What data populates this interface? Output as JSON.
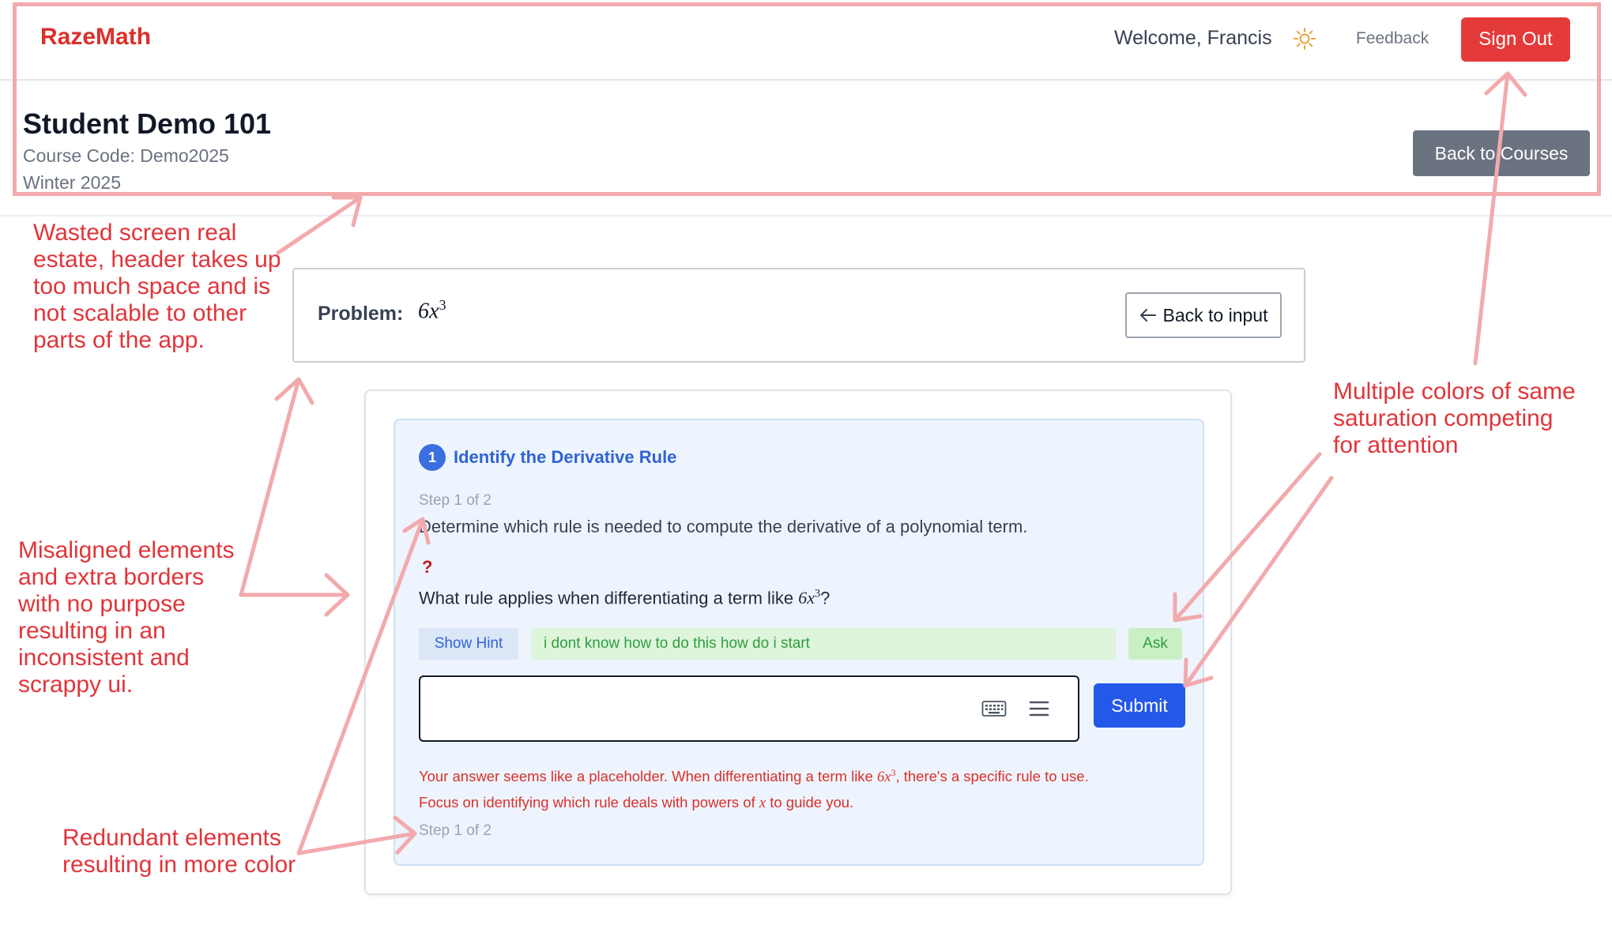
{
  "nav": {
    "brand": "RazeMath",
    "welcome": "Welcome, Francis",
    "theme_icon": "sun-icon",
    "feedback": "Feedback",
    "sign_out": "Sign Out"
  },
  "course": {
    "title": "Student Demo 101",
    "code": "Course Code: Demo2025",
    "term": "Winter 2025",
    "back_button": "Back to Courses"
  },
  "problem": {
    "label": "Problem:",
    "expression_base": "6x",
    "expression_exp": "3",
    "back_button": "Back to input",
    "back_icon": "arrow-left-icon"
  },
  "step": {
    "number": "1",
    "title": "Identify the Derivative Rule",
    "count": "Step 1 of 2",
    "description": "Determine which rule is needed to compute the derivative of a polynomial term.",
    "question_mark": "?",
    "question_prefix": "What rule applies when differentiating a term like ",
    "question_term": "6x",
    "question_exp": "3",
    "question_suffix": "?",
    "show_hint": "Show Hint",
    "hint_question": "i dont know how to do this how do i start",
    "ask": "Ask",
    "answer_value": "",
    "keyboard_icon": "keyboard-icon",
    "menu_icon": "menu-icon",
    "submit": "Submit",
    "feedback_line1_a": "Your answer seems like a placeholder. When differentiating a term like ",
    "feedback_term": "6x",
    "feedback_exp": "3",
    "feedback_line1_b": ", there's a specific rule to use.",
    "feedback_line2_a": "Focus on identifying which rule deals with powers of ",
    "feedback_var": "x",
    "feedback_line2_b": " to guide you.",
    "count_bottom": "Step 1 of 2"
  },
  "annotations": {
    "color": "#e0353a",
    "header": [
      "Wasted screen real",
      "estate, header takes up",
      "too much space and is",
      "not scalable to other",
      "parts of the app."
    ],
    "misaligned": [
      "Misaligned elements",
      "and extra borders",
      "with no purpose",
      "resulting in an",
      "inconsistent and",
      "scrappy ui."
    ],
    "redundant": [
      "Redundant elements",
      "resulting in more color"
    ],
    "colors": [
      "Multiple colors of same",
      "saturation competing",
      "for attention"
    ]
  }
}
